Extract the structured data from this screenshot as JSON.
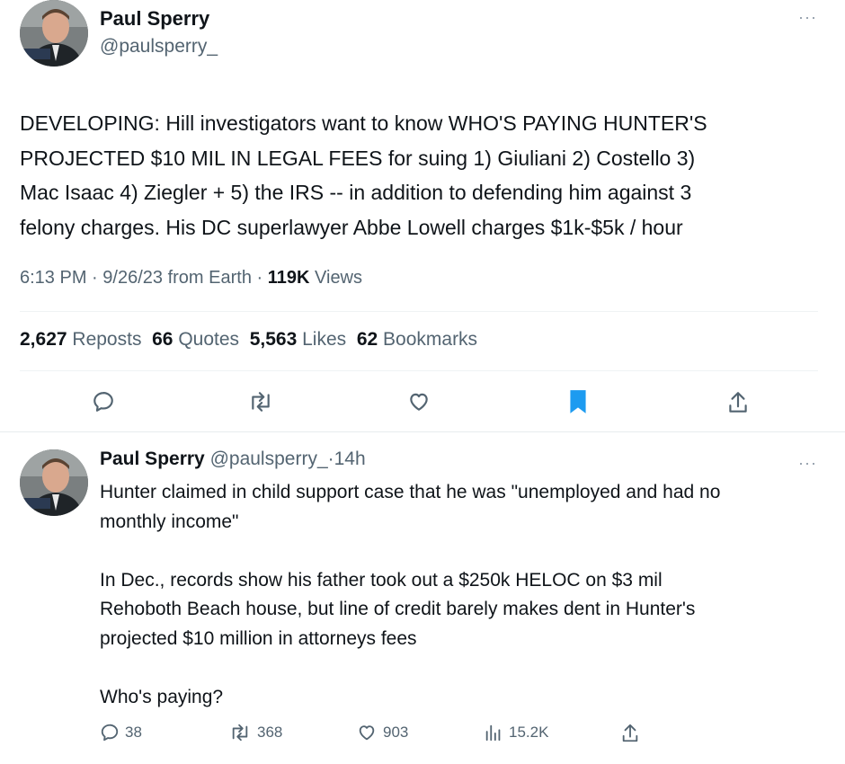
{
  "main_tweet": {
    "author_name": "Paul Sperry",
    "author_handle": "@paulsperry_",
    "text_lines": [
      "DEVELOPING: Hill investigators want to know WHO'S PAYING HUNTER'S",
      "PROJECTED $10 MIL IN LEGAL FEES for suing 1) Giuliani 2) Costello 3)",
      "Mac Isaac 4) Ziegler + 5) the IRS -- in addition to defending him against 3",
      "felony charges. His DC superlawyer Abbe Lowell charges $1k-$5k / hour"
    ],
    "meta": {
      "time": "6:13 PM",
      "sep1": "·",
      "date": "9/26/23",
      "source": "from Earth",
      "sep2": "·",
      "views_count": "119K",
      "views_label": "Views"
    },
    "stats": [
      {
        "count": "2,627",
        "label": "Reposts"
      },
      {
        "count": "66",
        "label": "Quotes"
      },
      {
        "count": "5,563",
        "label": "Likes"
      },
      {
        "count": "62",
        "label": "Bookmarks"
      }
    ],
    "actions": [
      "reply-icon",
      "repost-icon",
      "like-icon",
      "bookmark-filled-icon",
      "share-icon"
    ],
    "bookmark_color": "#1d9bf0"
  },
  "reply_tweet": {
    "author_name": "Paul Sperry",
    "author_handle": "@paulsperry_",
    "sep": "·",
    "time_ago": "14h",
    "text_lines": [
      "Hunter claimed in child support case that he was \"unemployed and had no",
      "monthly income\"",
      "",
      "In Dec., records show his father took out a $250k HELOC on $3 mil",
      "Rehoboth Beach house, but line of credit barely makes dent in Hunter's",
      "projected $10 million in attorneys fees",
      "",
      "Who's paying?"
    ],
    "counts": {
      "replies": "38",
      "reposts": "368",
      "likes": "903",
      "views": "15.2K"
    }
  },
  "more_label": "···"
}
